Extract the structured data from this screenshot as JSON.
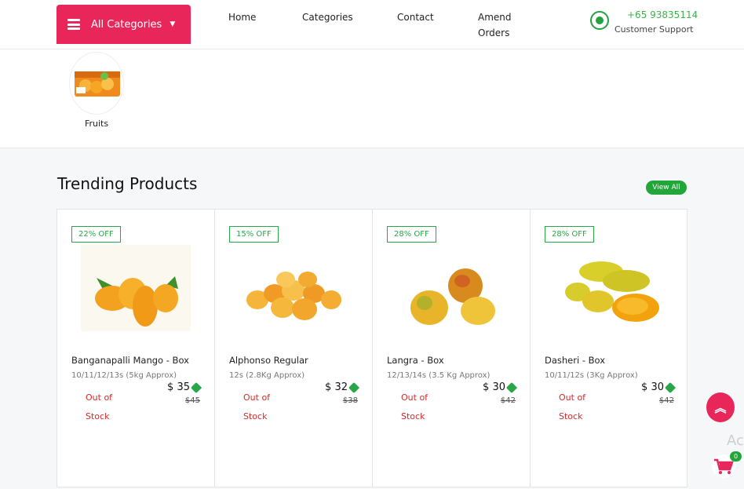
{
  "header": {
    "all_categories": "All Categories",
    "nav": [
      "Home",
      "Categories",
      "Contact",
      "Amend Orders"
    ],
    "phone": "+65 93835114",
    "support": "Customer Support"
  },
  "categories": [
    {
      "label": "Fruits"
    }
  ],
  "trending": {
    "title": "Trending Products",
    "view_all": "View All"
  },
  "products": [
    {
      "discount": "22% OFF",
      "name": "Banganapalli Mango - Box",
      "desc": "10/11/12/13s (5kg Approx)",
      "status": "Out of Stock",
      "price": "$ 35",
      "old_price": "$45"
    },
    {
      "discount": "15% OFF",
      "name": "Alphonso Regular",
      "desc": "12s (2.8Kg Approx)",
      "status": "Out of Stock",
      "price": "$ 32",
      "old_price": "$38"
    },
    {
      "discount": "28% OFF",
      "name": "Langra - Box",
      "desc": "12/13/14s (3.5 Kg Approx)",
      "status": "Out of Stock",
      "price": "$ 30",
      "old_price": "$42"
    },
    {
      "discount": "28% OFF",
      "name": "Dasheri - Box",
      "desc": "10/11/12s (3Kg Approx)",
      "status": "Out of Stock",
      "price": "$ 30",
      "old_price": "$42"
    }
  ],
  "floating": {
    "act_text": "Act",
    "cart_count": "0"
  },
  "colors": {
    "brand": "#e8265a",
    "accent": "#22a63a",
    "stock": "#d62a2a"
  }
}
